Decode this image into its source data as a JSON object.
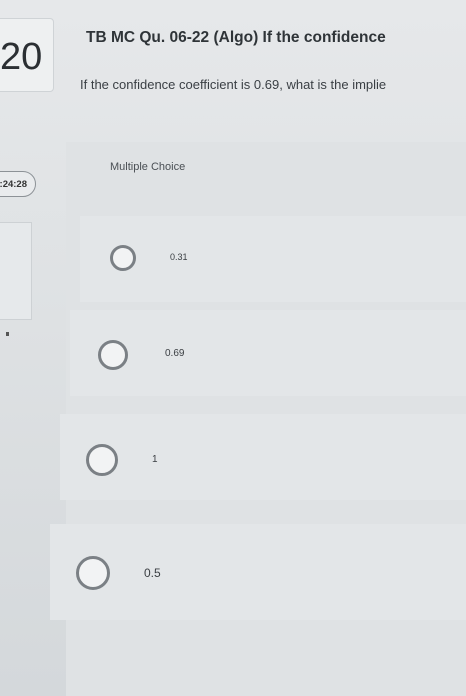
{
  "question": {
    "number": "20",
    "title": "TB MC Qu. 06-22 (Algo) If the confidence",
    "text": "If the confidence coefficient is 0.69, what is the implie",
    "timer": ":24:28",
    "type_label": "Multiple Choice"
  },
  "options": [
    {
      "label": "0.31",
      "selected": false
    },
    {
      "label": "0.69",
      "selected": false
    },
    {
      "label": "1",
      "selected": false
    },
    {
      "label": "0.5",
      "selected": false
    }
  ]
}
